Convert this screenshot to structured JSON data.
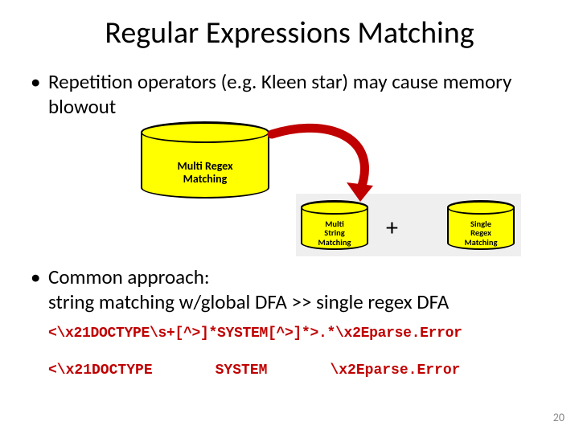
{
  "title": "Regular Expressions Matching",
  "bullets": {
    "b1": "Repetition operators (e.g. Kleen star) may cause memory blowout",
    "b2": "Common approach:\nstring matching w/global DFA >> single regex DFA"
  },
  "cylinders": {
    "big": "Multi Regex\nMatching",
    "small_a": "Multi\nString\nMatching",
    "small_b": "Single\nRegex\nMatching"
  },
  "plus": "+",
  "code": {
    "full": "<\\x21DOCTYPE\\s+[^>]*SYSTEM[^>]*>.*\\x2Eparse.Error",
    "part1": "<\\x21DOCTYPE",
    "part2": "SYSTEM",
    "part3": "\\x2Eparse.Error"
  },
  "slide_number": "20"
}
